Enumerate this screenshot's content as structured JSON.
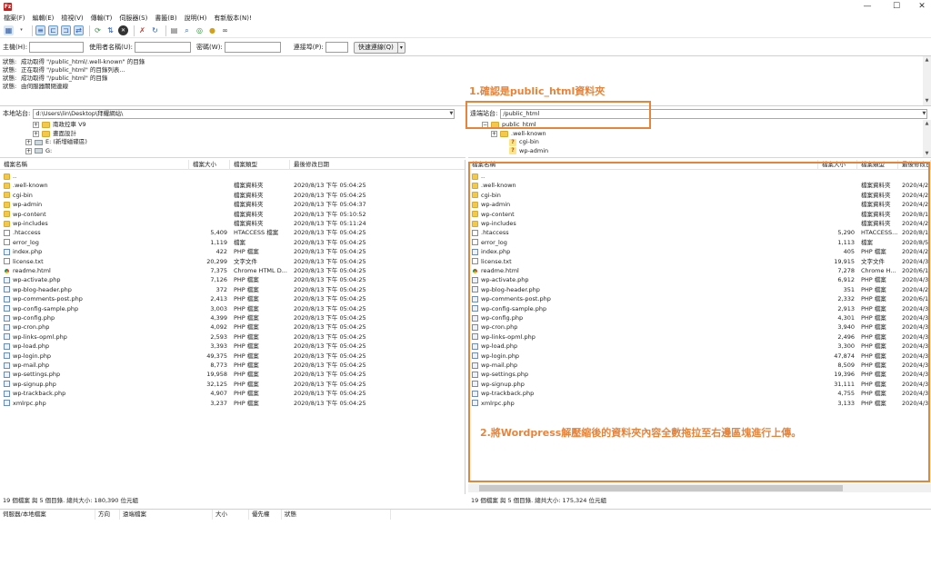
{
  "window": {
    "minimize": "—",
    "maximize": "☐",
    "close": "✕",
    "app_icon": "Fz"
  },
  "menu": [
    "檔案(F)",
    "編輯(E)",
    "檢視(V)",
    "傳輸(T)",
    "伺服器(S)",
    "書籤(B)",
    "說明(H)",
    "有新版本(N)!"
  ],
  "quickconnect": {
    "host_label": "主機(H):",
    "user_label": "使用者名稱(U):",
    "pass_label": "密碼(W):",
    "port_label": "連接埠(P):",
    "button": "快速連線(Q)",
    "dropdown": "▾"
  },
  "log": [
    {
      "label": "狀態:",
      "text": "成功取得 \"/public_html/.well-known\" 的目錄"
    },
    {
      "label": "狀態:",
      "text": "正在取得 \"/public_html\" 的目錄列表..."
    },
    {
      "label": "狀態:",
      "text": "成功取得 \"/public_html\" 的目錄"
    },
    {
      "label": "狀態:",
      "text": "由伺服器關閉連線"
    }
  ],
  "local": {
    "site_label": "本地站台:",
    "path": "d:\\Users\\lin\\Desktop\\拜耀網站\\",
    "tree": [
      {
        "exp": "+",
        "icon": "folder",
        "label": "南政控車  V9"
      },
      {
        "exp": "+",
        "icon": "folder",
        "label": "畫面設計"
      },
      {
        "exp": "+",
        "icon": "drive",
        "label": "E: (新增磁碟區)"
      },
      {
        "exp": "+",
        "icon": "drive",
        "label": "G:"
      }
    ],
    "columns": [
      "檔案名稱",
      "檔案大小",
      "檔案類型",
      "最後修改日期"
    ],
    "files": [
      {
        "icon": "folder",
        "name": "..",
        "size": "",
        "type": "",
        "date": ""
      },
      {
        "icon": "folder",
        "name": ".well-known",
        "size": "",
        "type": "檔案資料夾",
        "date": "2020/8/13 下午 05:04:25"
      },
      {
        "icon": "folder",
        "name": "cgi-bin",
        "size": "",
        "type": "檔案資料夾",
        "date": "2020/8/13 下午 05:04:25"
      },
      {
        "icon": "folder",
        "name": "wp-admin",
        "size": "",
        "type": "檔案資料夾",
        "date": "2020/8/13 下午 05:04:37"
      },
      {
        "icon": "folder",
        "name": "wp-content",
        "size": "",
        "type": "檔案資料夾",
        "date": "2020/8/13 下午 05:10:52"
      },
      {
        "icon": "folder",
        "name": "wp-includes",
        "size": "",
        "type": "檔案資料夾",
        "date": "2020/8/13 下午 05:11:24"
      },
      {
        "icon": "file",
        "name": ".htaccess",
        "size": "5,409",
        "type": "HTACCESS 檔案",
        "date": "2020/8/13 下午 05:04:25"
      },
      {
        "icon": "file",
        "name": "error_log",
        "size": "1,119",
        "type": "檔案",
        "date": "2020/8/13 下午 05:04:25"
      },
      {
        "icon": "php",
        "name": "index.php",
        "size": "422",
        "type": "PHP 檔案",
        "date": "2020/8/13 下午 05:04:25"
      },
      {
        "icon": "file",
        "name": "license.txt",
        "size": "20,299",
        "type": "文字文件",
        "date": "2020/8/13 下午 05:04:25"
      },
      {
        "icon": "chrome",
        "name": "readme.html",
        "size": "7,375",
        "type": "Chrome HTML D...",
        "date": "2020/8/13 下午 05:04:25"
      },
      {
        "icon": "php",
        "name": "wp-activate.php",
        "size": "7,126",
        "type": "PHP 檔案",
        "date": "2020/8/13 下午 05:04:25"
      },
      {
        "icon": "php",
        "name": "wp-blog-header.php",
        "size": "372",
        "type": "PHP 檔案",
        "date": "2020/8/13 下午 05:04:25"
      },
      {
        "icon": "php",
        "name": "wp-comments-post.php",
        "size": "2,413",
        "type": "PHP 檔案",
        "date": "2020/8/13 下午 05:04:25"
      },
      {
        "icon": "php",
        "name": "wp-config-sample.php",
        "size": "3,003",
        "type": "PHP 檔案",
        "date": "2020/8/13 下午 05:04:25"
      },
      {
        "icon": "php",
        "name": "wp-config.php",
        "size": "4,399",
        "type": "PHP 檔案",
        "date": "2020/8/13 下午 05:04:25"
      },
      {
        "icon": "php",
        "name": "wp-cron.php",
        "size": "4,092",
        "type": "PHP 檔案",
        "date": "2020/8/13 下午 05:04:25"
      },
      {
        "icon": "php",
        "name": "wp-links-opml.php",
        "size": "2,593",
        "type": "PHP 檔案",
        "date": "2020/8/13 下午 05:04:25"
      },
      {
        "icon": "php",
        "name": "wp-load.php",
        "size": "3,393",
        "type": "PHP 檔案",
        "date": "2020/8/13 下午 05:04:25"
      },
      {
        "icon": "php",
        "name": "wp-login.php",
        "size": "49,375",
        "type": "PHP 檔案",
        "date": "2020/8/13 下午 05:04:25"
      },
      {
        "icon": "php",
        "name": "wp-mail.php",
        "size": "8,773",
        "type": "PHP 檔案",
        "date": "2020/8/13 下午 05:04:25"
      },
      {
        "icon": "php",
        "name": "wp-settings.php",
        "size": "19,958",
        "type": "PHP 檔案",
        "date": "2020/8/13 下午 05:04:25"
      },
      {
        "icon": "php",
        "name": "wp-signup.php",
        "size": "32,125",
        "type": "PHP 檔案",
        "date": "2020/8/13 下午 05:04:25"
      },
      {
        "icon": "php",
        "name": "wp-trackback.php",
        "size": "4,907",
        "type": "PHP 檔案",
        "date": "2020/8/13 下午 05:04:25"
      },
      {
        "icon": "php",
        "name": "xmlrpc.php",
        "size": "3,237",
        "type": "PHP 檔案",
        "date": "2020/8/13 下午 05:04:25"
      }
    ],
    "status": "19 個檔案 與 5 個目錄. 總共大小: 180,390 位元組"
  },
  "remote": {
    "site_label": "遠端站台:",
    "path": "/public_html",
    "tree": [
      {
        "exp": "−",
        "icon": "folder",
        "label": "public_html"
      },
      {
        "exp": "+",
        "icon": "folder",
        "label": ".well-known"
      },
      {
        "exp": "",
        "icon": "q",
        "label": "cgi-bin"
      },
      {
        "exp": "",
        "icon": "q",
        "label": "wp-admin"
      }
    ],
    "columns": [
      "檔案名稱",
      "檔案大小",
      "檔案類型",
      "最後修改日"
    ],
    "files": [
      {
        "icon": "folder",
        "name": "..",
        "size": "",
        "type": "",
        "date": ""
      },
      {
        "icon": "folder",
        "name": ".well-known",
        "size": "",
        "type": "檔案資料夾",
        "date": "2020/4/2"
      },
      {
        "icon": "folder",
        "name": "cgi-bin",
        "size": "",
        "type": "檔案資料夾",
        "date": "2020/4/2"
      },
      {
        "icon": "folder",
        "name": "wp-admin",
        "size": "",
        "type": "檔案資料夾",
        "date": "2020/4/2"
      },
      {
        "icon": "folder",
        "name": "wp-content",
        "size": "",
        "type": "檔案資料夾",
        "date": "2020/8/1"
      },
      {
        "icon": "folder",
        "name": "wp-includes",
        "size": "",
        "type": "檔案資料夾",
        "date": "2020/4/2"
      },
      {
        "icon": "file",
        "name": ".htaccess",
        "size": "5,290",
        "type": "HTACCESS...",
        "date": "2020/8/1"
      },
      {
        "icon": "file",
        "name": "error_log",
        "size": "1,113",
        "type": "檔案",
        "date": "2020/8/5"
      },
      {
        "icon": "php",
        "name": "index.php",
        "size": "405",
        "type": "PHP 檔案",
        "date": "2020/4/2"
      },
      {
        "icon": "file",
        "name": "license.txt",
        "size": "19,915",
        "type": "文字文件",
        "date": "2020/4/3"
      },
      {
        "icon": "chrome",
        "name": "readme.html",
        "size": "7,278",
        "type": "Chrome H...",
        "date": "2020/6/1"
      },
      {
        "icon": "php",
        "name": "wp-activate.php",
        "size": "6,912",
        "type": "PHP 檔案",
        "date": "2020/4/3"
      },
      {
        "icon": "php",
        "name": "wp-blog-header.php",
        "size": "351",
        "type": "PHP 檔案",
        "date": "2020/4/2"
      },
      {
        "icon": "php",
        "name": "wp-comments-post.php",
        "size": "2,332",
        "type": "PHP 檔案",
        "date": "2020/6/1"
      },
      {
        "icon": "php",
        "name": "wp-config-sample.php",
        "size": "2,913",
        "type": "PHP 檔案",
        "date": "2020/4/3"
      },
      {
        "icon": "php",
        "name": "wp-config.php",
        "size": "4,301",
        "type": "PHP 檔案",
        "date": "2020/4/3"
      },
      {
        "icon": "php",
        "name": "wp-cron.php",
        "size": "3,940",
        "type": "PHP 檔案",
        "date": "2020/4/3"
      },
      {
        "icon": "php",
        "name": "wp-links-opml.php",
        "size": "2,496",
        "type": "PHP 檔案",
        "date": "2020/4/3"
      },
      {
        "icon": "php",
        "name": "wp-load.php",
        "size": "3,300",
        "type": "PHP 檔案",
        "date": "2020/4/3"
      },
      {
        "icon": "php",
        "name": "wp-login.php",
        "size": "47,874",
        "type": "PHP 檔案",
        "date": "2020/4/3"
      },
      {
        "icon": "php",
        "name": "wp-mail.php",
        "size": "8,509",
        "type": "PHP 檔案",
        "date": "2020/4/3"
      },
      {
        "icon": "php",
        "name": "wp-settings.php",
        "size": "19,396",
        "type": "PHP 檔案",
        "date": "2020/4/3"
      },
      {
        "icon": "php",
        "name": "wp-signup.php",
        "size": "31,111",
        "type": "PHP 檔案",
        "date": "2020/4/3"
      },
      {
        "icon": "php",
        "name": "wp-trackback.php",
        "size": "4,755",
        "type": "PHP 檔案",
        "date": "2020/4/3"
      },
      {
        "icon": "php",
        "name": "xmlrpc.php",
        "size": "3,133",
        "type": "PHP 檔案",
        "date": "2020/4/3"
      }
    ],
    "status": "19 個檔案 與 5 個目錄. 總共大小: 175,324 位元組"
  },
  "queue": {
    "columns": [
      "伺服器/本地檔案",
      "方向",
      "遠端檔案",
      "大小",
      "優先權",
      "狀態"
    ]
  },
  "annotations": {
    "color": "#e7843b",
    "step1": "1.確認是public_html資料夾",
    "step2": "2.將Wordpress解壓縮後的資料夾內容全數拖拉至右邊區塊進行上傳。"
  }
}
